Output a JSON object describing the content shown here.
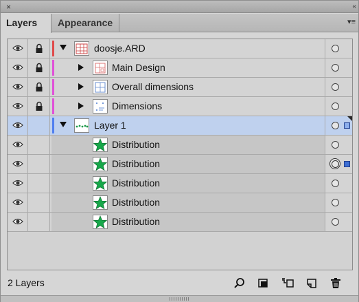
{
  "window": {
    "close_icon": "×",
    "collapse_icon": "«"
  },
  "tabs": [
    {
      "label": "Layers",
      "active": true
    },
    {
      "label": "Appearance",
      "active": false
    }
  ],
  "panel_menu_icon": "▾≡",
  "layers": [
    {
      "name": "doosje.ARD",
      "level": 0,
      "expanded": true,
      "locked": true,
      "color": "#e04a4a",
      "thumbnail": "document-thumb",
      "target": "ring",
      "selection": "none"
    },
    {
      "name": "Main Design",
      "level": 1,
      "expanded": false,
      "locked": true,
      "color": "#e050d8",
      "thumbnail": "design-thumb",
      "target": "ring",
      "selection": "none"
    },
    {
      "name": "Overall dimensions",
      "level": 1,
      "expanded": false,
      "locked": true,
      "color": "#e050d8",
      "thumbnail": "grid-thumb",
      "target": "ring",
      "selection": "none"
    },
    {
      "name": "Dimensions",
      "level": 1,
      "expanded": false,
      "locked": true,
      "color": "#e050d8",
      "thumbnail": "dims-thumb",
      "target": "ring",
      "selection": "none"
    },
    {
      "name": "Layer 1",
      "level": 0,
      "expanded": true,
      "locked": false,
      "color": "#4f7ef0",
      "thumbnail": "dots-thumb",
      "target": "ring",
      "selection": "outline",
      "selected": true
    },
    {
      "name": "Distribution",
      "level": 2,
      "locked": false,
      "color": "#4f7ef0",
      "thumbnail": "star-thumb",
      "target": "ring",
      "selection": "none"
    },
    {
      "name": "Distribution",
      "level": 2,
      "locked": false,
      "color": "#4f7ef0",
      "thumbnail": "star-thumb",
      "target": "double-ring",
      "selection": "filled"
    },
    {
      "name": "Distribution",
      "level": 2,
      "locked": false,
      "color": "#4f7ef0",
      "thumbnail": "star-thumb",
      "target": "ring",
      "selection": "none"
    },
    {
      "name": "Distribution",
      "level": 2,
      "locked": false,
      "color": "#4f7ef0",
      "thumbnail": "star-thumb",
      "target": "ring",
      "selection": "none"
    },
    {
      "name": "Distribution",
      "level": 2,
      "locked": false,
      "color": "#4f7ef0",
      "thumbnail": "star-thumb",
      "target": "ring",
      "selection": "none"
    }
  ],
  "footer": {
    "count_label": "2 Layers",
    "tools": [
      "locate-object-icon",
      "make-clipping-mask-icon",
      "create-sublayer-icon",
      "create-layer-icon",
      "trash-icon"
    ]
  }
}
